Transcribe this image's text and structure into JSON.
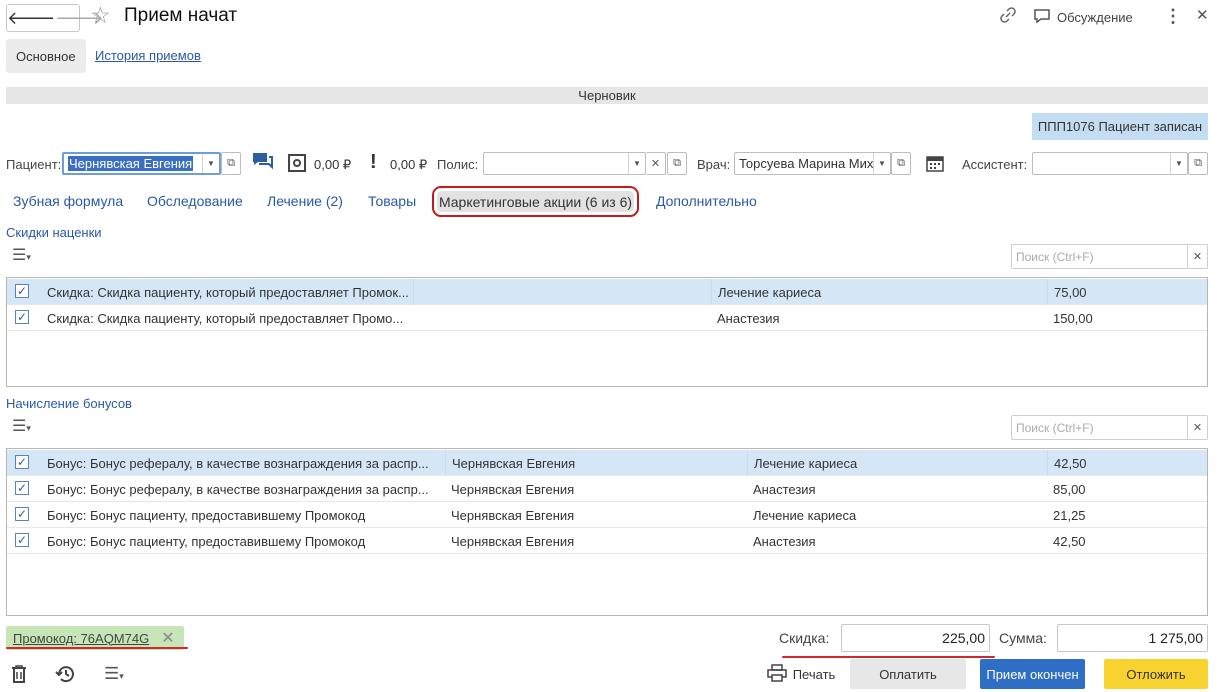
{
  "window": {
    "title": "Прием начат",
    "discussion_label": "Обсуждение"
  },
  "tabs": {
    "main": "Основное",
    "history": "История приемов"
  },
  "status": "Черновик",
  "badge": "ППП1076  Пациент записан",
  "patient_row": {
    "patient_label": "Пациент:",
    "patient_value": "Чернявская Евгения",
    "balance1": "0,00 ₽",
    "balance2": "0,00 ₽",
    "policy_label": "Полис:",
    "policy_value": "",
    "doctor_label": "Врач:",
    "doctor_value": "Торсуева Марина Мих",
    "assistant_label": "Ассистент:",
    "assistant_value": ""
  },
  "subtabs": [
    "Зубная формула",
    "Обследование",
    "Лечение (2)",
    "Товары",
    "Маркетинговые акции (6 из 6)",
    "Дополнительно"
  ],
  "discounts": {
    "title": "Скидки наценки",
    "search_placeholder": "Поиск (Ctrl+F)",
    "rows": [
      {
        "name": "Скидка: Скидка пациенту, который предоставляет Промок...",
        "service": "Лечение кариеса",
        "amount": "75,00"
      },
      {
        "name": "Скидка: Скидка пациенту, который предоставляет Промо...",
        "service": "Анастезия",
        "amount": "150,00"
      }
    ]
  },
  "bonuses": {
    "title": "Начисление бонусов",
    "search_placeholder": "Поиск (Ctrl+F)",
    "rows": [
      {
        "name": "Бонус: Бонус рефералу, в качестве вознаграждения за распр...",
        "patient": "Чернявская Евгения",
        "service": "Лечение кариеса",
        "amount": "42,50"
      },
      {
        "name": "Бонус: Бонус рефералу, в качестве вознаграждения за распр...",
        "patient": "Чернявская Евгения",
        "service": "Анастезия",
        "amount": "85,00"
      },
      {
        "name": "Бонус: Бонус пациенту, предоставившему Промокод",
        "patient": "Чернявская Евгения",
        "service": "Лечение кариеса",
        "amount": "21,25"
      },
      {
        "name": "Бонус: Бонус пациенту, предоставившему Промокод",
        "patient": "Чернявская Евгения",
        "service": "Анастезия",
        "amount": "42,50"
      }
    ]
  },
  "footer": {
    "promo_label": "Промокод: 76AQM74G",
    "discount_label": "Скидка:",
    "discount_value": "225,00",
    "sum_label": "Сумма:",
    "sum_value": "1 275,00",
    "print_label": "Печать",
    "pay_label": "Оплатить",
    "finish_label": "Прием окончен",
    "postpone_label": "Отложить"
  },
  "colors": {
    "accent_blue": "#2e6ec4",
    "yellow": "#f8d22e",
    "highlight_red": "#d0282f",
    "promo_green": "#c7e6b8"
  }
}
